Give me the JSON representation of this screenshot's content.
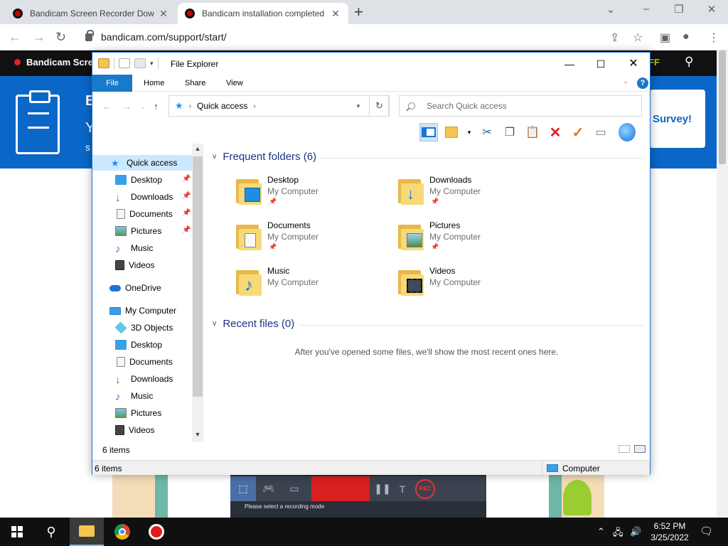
{
  "browser": {
    "tabs": [
      {
        "title": "Bandicam Screen Recorder Dow",
        "active": false
      },
      {
        "title": "Bandicam installation completed",
        "active": true
      }
    ],
    "new_tab": "+",
    "url": "bandicam.com/support/start/"
  },
  "site": {
    "brand": "Bandicam Scree",
    "off_label": "FF",
    "hero_line1": "B",
    "hero_line2": "Y",
    "hero_line3": "s",
    "survey_label": "Survey!",
    "bandicam_status": "Please select a recording mode",
    "rec_label": "REC"
  },
  "explorer": {
    "title": "File Explorer",
    "ribbon_tabs": [
      "File",
      "Home",
      "Share",
      "View"
    ],
    "help": "?",
    "address": "Quick access",
    "search_placeholder": "Search Quick access",
    "nav": {
      "quick_access": "Quick access",
      "pinned": [
        "Desktop",
        "Downloads",
        "Documents",
        "Pictures"
      ],
      "unpinned": [
        "Music",
        "Videos"
      ],
      "onedrive": "OneDrive",
      "my_computer": "My Computer",
      "computer_items": [
        "3D Objects",
        "Desktop",
        "Documents",
        "Downloads",
        "Music",
        "Pictures",
        "Videos"
      ]
    },
    "frequent_header": "Frequent folders (6)",
    "folders": [
      {
        "name": "Desktop",
        "location": "My Computer",
        "pinned": true,
        "icon": "desktop-folder-icon"
      },
      {
        "name": "Downloads",
        "location": "My Computer",
        "pinned": true,
        "icon": "downloads-folder-icon"
      },
      {
        "name": "Documents",
        "location": "My Computer",
        "pinned": true,
        "icon": "documents-folder-icon"
      },
      {
        "name": "Pictures",
        "location": "My Computer",
        "pinned": true,
        "icon": "pictures-folder-icon"
      },
      {
        "name": "Music",
        "location": "My Computer",
        "pinned": false,
        "icon": "music-folder-icon"
      },
      {
        "name": "Videos",
        "location": "My Computer",
        "pinned": false,
        "icon": "videos-folder-icon"
      }
    ],
    "recent_header": "Recent files (0)",
    "recent_empty": "After you've opened some files, we'll show the most recent ones here.",
    "items_count": "6 items",
    "status_items": "6 items",
    "status_location": "Computer"
  },
  "taskbar": {
    "time": "6:52 PM",
    "date": "3/25/2022"
  },
  "colors": {
    "accent": "#1979ca",
    "hero_blue": "#0a67c7",
    "header_text": "#1e3287"
  }
}
